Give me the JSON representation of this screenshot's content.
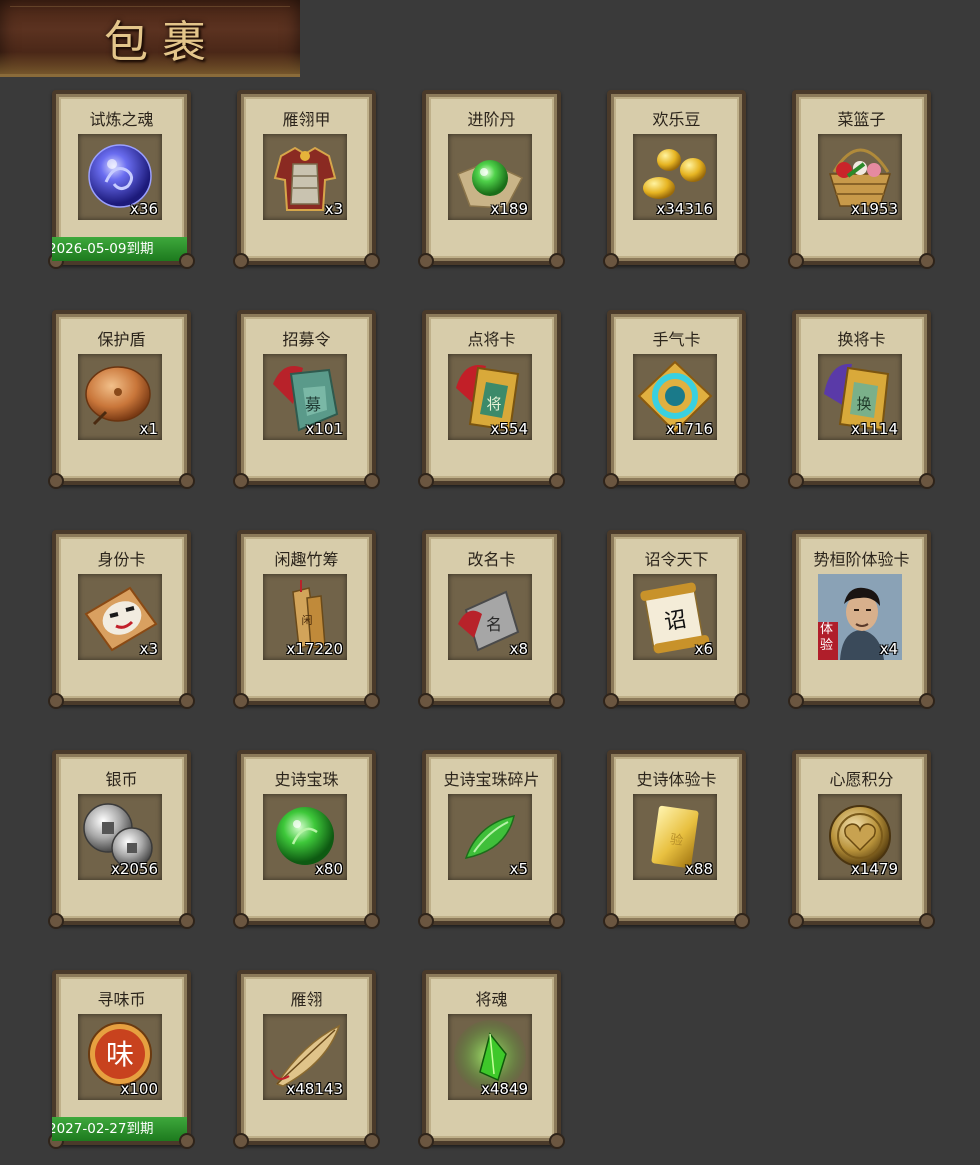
{
  "title": "包裹",
  "items": [
    {
      "name": "试炼之魂",
      "qty": "x36",
      "icon": "dragon-orb-icon",
      "expiry": "2026-05-09到期"
    },
    {
      "name": "雁翎甲",
      "qty": "x3",
      "icon": "armor-icon"
    },
    {
      "name": "进阶丹",
      "qty": "x189",
      "icon": "green-pill-icon"
    },
    {
      "name": "欢乐豆",
      "qty": "x34316",
      "icon": "golden-beans-icon"
    },
    {
      "name": "菜篮子",
      "qty": "x1953",
      "icon": "basket-icon"
    },
    {
      "name": "保护盾",
      "qty": "x1",
      "icon": "round-shield-icon"
    },
    {
      "name": "招募令",
      "qty": "x101",
      "icon": "recruit-token-icon"
    },
    {
      "name": "点将卡",
      "qty": "x554",
      "icon": "general-card-icon"
    },
    {
      "name": "手气卡",
      "qty": "x1716",
      "icon": "luck-card-icon"
    },
    {
      "name": "换将卡",
      "qty": "x1114",
      "icon": "swap-card-icon"
    },
    {
      "name": "身份卡",
      "qty": "x3",
      "icon": "identity-mask-card-icon"
    },
    {
      "name": "闲趣竹筹",
      "qty": "x17220",
      "icon": "bamboo-tally-icon"
    },
    {
      "name": "改名卡",
      "qty": "x8",
      "icon": "rename-card-icon"
    },
    {
      "name": "诏令天下",
      "qty": "x6",
      "icon": "edict-scroll-icon"
    },
    {
      "name": "势桓阶体验卡",
      "qty": "x4",
      "icon": "hero-portrait-icon",
      "portrait_tag": "体验"
    },
    {
      "name": "银币",
      "qty": "x2056",
      "icon": "silver-coins-icon"
    },
    {
      "name": "史诗宝珠",
      "qty": "x80",
      "icon": "epic-orb-icon"
    },
    {
      "name": "史诗宝珠碎片",
      "qty": "x5",
      "icon": "orb-shard-icon"
    },
    {
      "name": "史诗体验卡",
      "qty": "x88",
      "icon": "gold-card-icon"
    },
    {
      "name": "心愿积分",
      "qty": "x1479",
      "icon": "heart-coin-icon"
    },
    {
      "name": "寻味币",
      "qty": "x100",
      "icon": "flavor-coin-icon",
      "coin_char": "味",
      "expiry": "2027-02-27到期"
    },
    {
      "name": "雁翎",
      "qty": "x48143",
      "icon": "feather-icon"
    },
    {
      "name": "将魂",
      "qty": "x4849",
      "icon": "soul-crystal-icon"
    }
  ],
  "colors": {
    "background": "#3a3a3a",
    "card": "#d7ccaa",
    "card_border": "#4a3a2a",
    "icon_bg": "#716349",
    "expiry_bar": "#2a8f2a"
  }
}
